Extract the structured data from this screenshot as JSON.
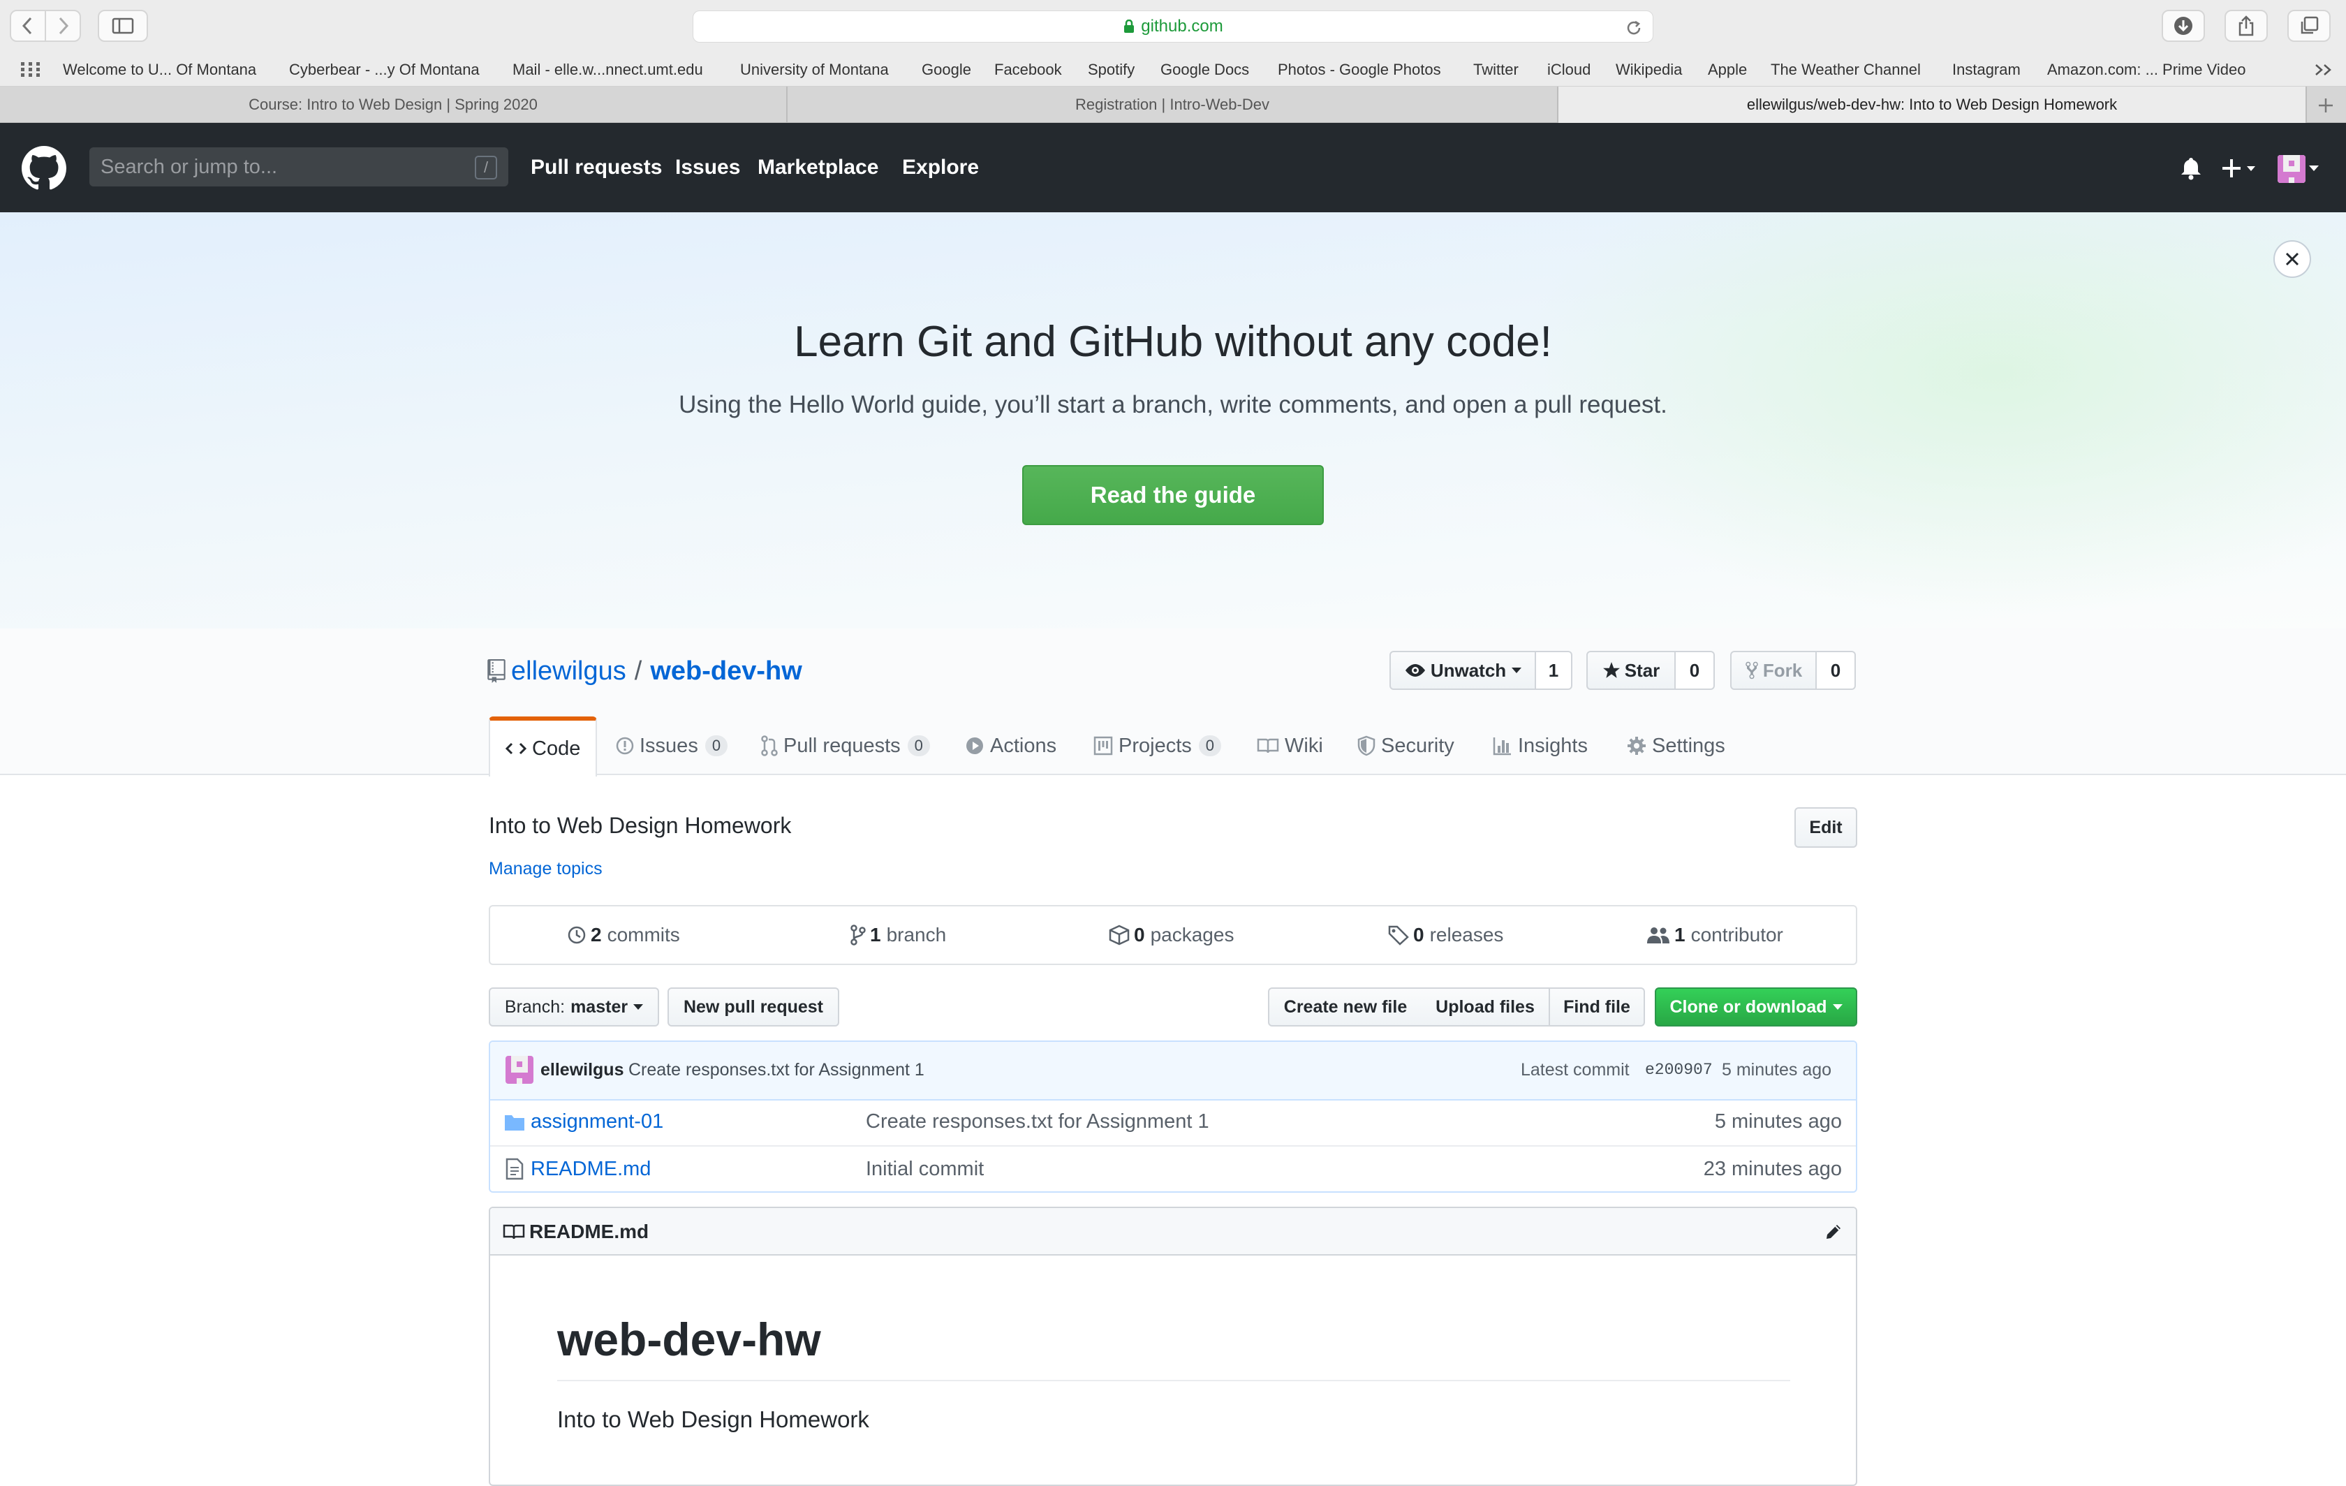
{
  "browser": {
    "url": "github.com",
    "favorites": [
      "Welcome to U... Of Montana",
      "Cyberbear - ...y Of Montana",
      "Mail - elle.w...nnect.umt.edu",
      "University of Montana",
      "Google",
      "Facebook",
      "Spotify",
      "Google Docs",
      "Photos - Google Photos",
      "Twitter",
      "iCloud",
      "Wikipedia",
      "Apple",
      "The Weather Channel",
      "Instagram",
      "Amazon.com: ... Prime Video"
    ],
    "tabs": [
      {
        "label": "Course: Intro to Web Design | Spring 2020",
        "active": false
      },
      {
        "label": "Registration | Intro-Web-Dev",
        "active": false
      },
      {
        "label": "ellewilgus/web-dev-hw: Into to Web Design Homework",
        "active": true
      }
    ]
  },
  "gh_header": {
    "search_placeholder": "Search or jump to...",
    "search_shortcut": "/",
    "nav": [
      "Pull requests",
      "Issues",
      "Marketplace",
      "Explore"
    ]
  },
  "banner": {
    "title": "Learn Git and GitHub without any code!",
    "subtitle": "Using the Hello World guide, you’ll start a branch, write comments, and open a pull request.",
    "button": "Read the guide"
  },
  "repo": {
    "owner": "ellewilgus",
    "separator": "/",
    "name": "web-dev-hw",
    "unwatch_label": "Unwatch",
    "watch_count": "1",
    "star_label": "Star",
    "star_count": "0",
    "fork_label": "Fork",
    "fork_count": "0",
    "tabs": [
      {
        "label": "Code",
        "count": "",
        "icon": "code-icon",
        "active": true
      },
      {
        "label": "Issues",
        "count": "0",
        "icon": "issue-icon"
      },
      {
        "label": "Pull requests",
        "count": "0",
        "icon": "pull-request-icon"
      },
      {
        "label": "Actions",
        "count": "",
        "icon": "play-icon"
      },
      {
        "label": "Projects",
        "count": "0",
        "icon": "project-icon"
      },
      {
        "label": "Wiki",
        "count": "",
        "icon": "book-icon"
      },
      {
        "label": "Security",
        "count": "",
        "icon": "shield-icon"
      },
      {
        "label": "Insights",
        "count": "",
        "icon": "graph-icon"
      },
      {
        "label": "Settings",
        "count": "",
        "icon": "gear-icon"
      }
    ],
    "description": "Into to Web Design Homework",
    "edit_label": "Edit",
    "manage_topics": "Manage topics",
    "summary": [
      {
        "count": "2",
        "label": "commits",
        "icon": "history-icon"
      },
      {
        "count": "1",
        "label": "branch",
        "icon": "branch-icon"
      },
      {
        "count": "0",
        "label": "packages",
        "icon": "package-icon"
      },
      {
        "count": "0",
        "label": "releases",
        "icon": "tag-icon"
      },
      {
        "count": "1",
        "label": "contributor",
        "icon": "people-icon"
      }
    ],
    "branch_prefix": "Branch:",
    "branch_name": "master",
    "new_pr": "New pull request",
    "create_file": "Create new file",
    "upload_files": "Upload files",
    "find_file": "Find file",
    "clone": "Clone or download",
    "latest_commit": {
      "author": "ellewilgus",
      "message": "Create responses.txt for Assignment 1",
      "prefix": "Latest commit",
      "sha": "e200907",
      "time": "5 minutes ago"
    },
    "files": [
      {
        "name": "assignment-01",
        "type": "folder-icon",
        "message": "Create responses.txt for Assignment 1",
        "time": "5 minutes ago"
      },
      {
        "name": "README.md",
        "type": "file-icon",
        "message": "Initial commit",
        "time": "23 minutes ago"
      }
    ],
    "readme": {
      "filename": "README.md",
      "heading": "web-dev-hw",
      "body": "Into to Web Design Homework"
    }
  },
  "colors": {
    "accent_link": "#0366d6",
    "header_bg": "#24292e",
    "primary_green": "#28a745",
    "tab_active_border": "#e36209"
  }
}
